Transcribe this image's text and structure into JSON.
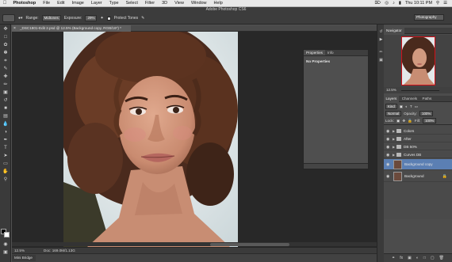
{
  "menubar": {
    "apple": "",
    "items": [
      "Photoshop",
      "File",
      "Edit",
      "Image",
      "Layer",
      "Type",
      "Select",
      "Filter",
      "3D",
      "View",
      "Window",
      "Help"
    ],
    "clock": "Thu 10:11 PM"
  },
  "window": {
    "title": "Adobe Photoshop CS6"
  },
  "options": {
    "range_label": "Range:",
    "range_value": "Midtones",
    "exposure_label": "Exposure:",
    "exposure_value": "29%",
    "protect_tones_label": "Protect Tones",
    "protect_tones_checked": true,
    "workspace": "Photography"
  },
  "document": {
    "tab_title": "_DSC1801-Edit 2.psd @ 12.5% (Background copy, RGB/16*) *",
    "zoom": "12.5%",
    "doc_info": "Doc: 169.0M/1.13G"
  },
  "properties": {
    "tabs": [
      "Properties",
      "Info"
    ],
    "active_tab": "Properties",
    "message": "No Properties"
  },
  "navigator": {
    "tab": "Navigator",
    "zoom": "12.5%"
  },
  "layers": {
    "tabs": [
      "Layers",
      "Channels",
      "Paths"
    ],
    "active_tab": "Layers",
    "kind_label": "Kind",
    "blend_mode": "Normal",
    "opacity_label": "Opacity:",
    "opacity_value": "100%",
    "lock_label": "Lock:",
    "fill_label": "Fill:",
    "fill_value": "100%",
    "items": [
      {
        "name": "Colors",
        "type": "group"
      },
      {
        "name": "After",
        "type": "group"
      },
      {
        "name": "DB 50%",
        "type": "group"
      },
      {
        "name": "Curves DB",
        "type": "group"
      },
      {
        "name": "Background copy",
        "type": "image",
        "selected": true
      },
      {
        "name": "Background",
        "type": "image",
        "locked": true
      }
    ]
  },
  "mini_bridge": {
    "label": "Mini Bridge"
  },
  "colors": {
    "selection": "#5b7fb3",
    "navigator_box": "#d0101a"
  }
}
